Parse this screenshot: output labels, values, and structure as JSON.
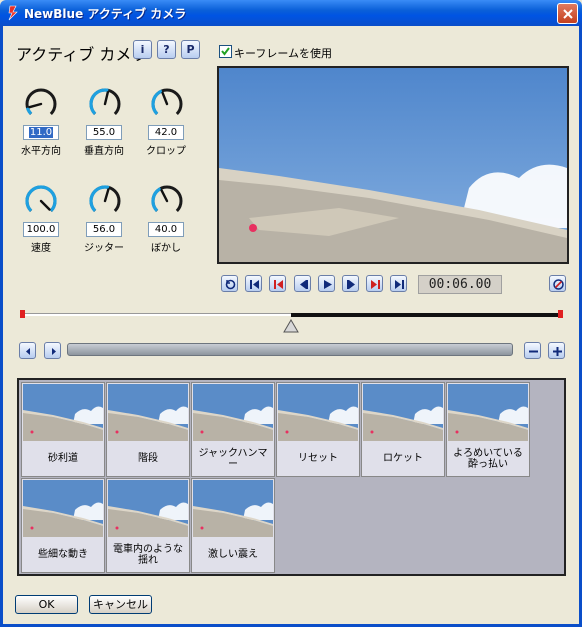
{
  "window": {
    "title": "NewBlue アクティブ カメラ"
  },
  "panel": {
    "title": "アクティブ カメラ",
    "info_label": "i",
    "help_label": "?",
    "presets_label": "P"
  },
  "knobs": [
    {
      "label": "水平方向",
      "value": "11.0",
      "level": 0.11
    },
    {
      "label": "垂直方向",
      "value": "55.0",
      "level": 0.55
    },
    {
      "label": "クロップ",
      "value": "42.0",
      "level": 0.42
    },
    {
      "label": "速度",
      "value": "100.0",
      "level": 1.0
    },
    {
      "label": "ジッター",
      "value": "56.0",
      "level": 0.56
    },
    {
      "label": "ぼかし",
      "value": "40.0",
      "level": 0.4
    }
  ],
  "keyframe": {
    "label": "キーフレームを使用",
    "checked": true
  },
  "transport": {
    "timecode": "00:06.00",
    "icons": [
      "loop-icon",
      "go-to-start-icon",
      "previous-keyframe-icon",
      "step-back-icon",
      "play-icon",
      "step-forward-icon",
      "next-keyframe-icon",
      "go-to-end-icon",
      "no-keyframe-icon"
    ]
  },
  "timeline": {
    "position": 0.5
  },
  "presets": [
    {
      "label": "砂利道"
    },
    {
      "label": "階段"
    },
    {
      "label": "ジャックハンマー"
    },
    {
      "label": "リセット"
    },
    {
      "label": "ロケット"
    },
    {
      "label": "よろめいている酔っ払い"
    },
    {
      "label": "些細な動き"
    },
    {
      "label": "電車内のような揺れ"
    },
    {
      "label": "激しい震え"
    }
  ],
  "buttons": {
    "ok": "OK",
    "cancel": "キャンセル"
  },
  "colors": {
    "title_bar": "#0054e3",
    "knob_arc": "#1ea0e0",
    "timeline_marker": "#e02020"
  }
}
